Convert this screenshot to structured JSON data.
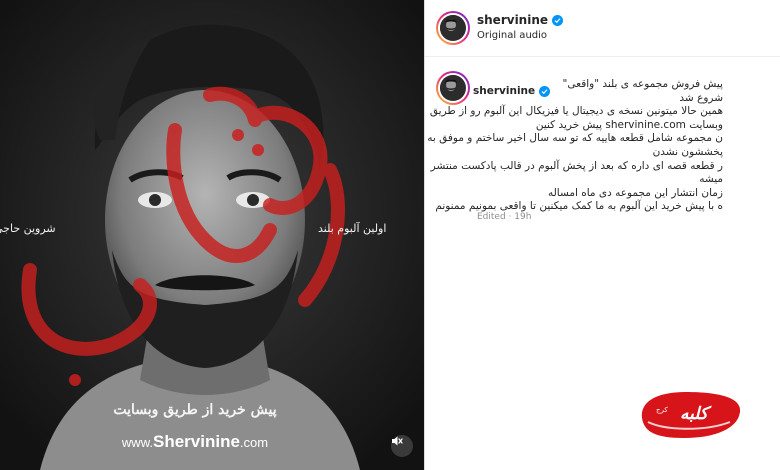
{
  "media": {
    "overlay_calligraphy": "واقعی",
    "debut_text": "اولین آلبوم بلند",
    "artist_name": "شروین حاجی",
    "presale_text": "پیش خرید از طریق وبسایت",
    "site_prefix": "www.",
    "site_main": "Shervinine",
    "site_suffix": ".com",
    "mute_icon": "speaker-muted-icon"
  },
  "post": {
    "username": "shervinine",
    "audio_label": "Original audio",
    "edited_label": "Edited",
    "time_ago": "19h"
  },
  "caption": {
    "first_line": "پیش فروش مجموعه ی بلند \"واقعی\" شروع شد",
    "lines": [
      "همین حالا میتونین نسخه ی دیجیتال یا فیزیکال این آلبوم رو از طریق",
      "وبسایت shervinine.com پیش خرید کنین",
      "ن مجموعه شامل قطعه هاییه که تو سه سال اخیر ساختم و موفق به",
      "پخششون نشدن",
      "ر قطعه قصه ای داره که بعد از پخش آلبوم در قالب پادکست منتشر",
      "میشه",
      "زمان انتشار این مجموعه دی ماه امساله",
      "ه با پیش خرید این آلبوم به ما کمک میکنین تا واقعی بمونیم ممنونم"
    ]
  },
  "watermark": {
    "text": "کلبه",
    "small_text": "کرج"
  },
  "colors": {
    "verified_blue": "#0095f6",
    "overlay_red": "#c8201f",
    "watermark_red": "#d7141a"
  }
}
